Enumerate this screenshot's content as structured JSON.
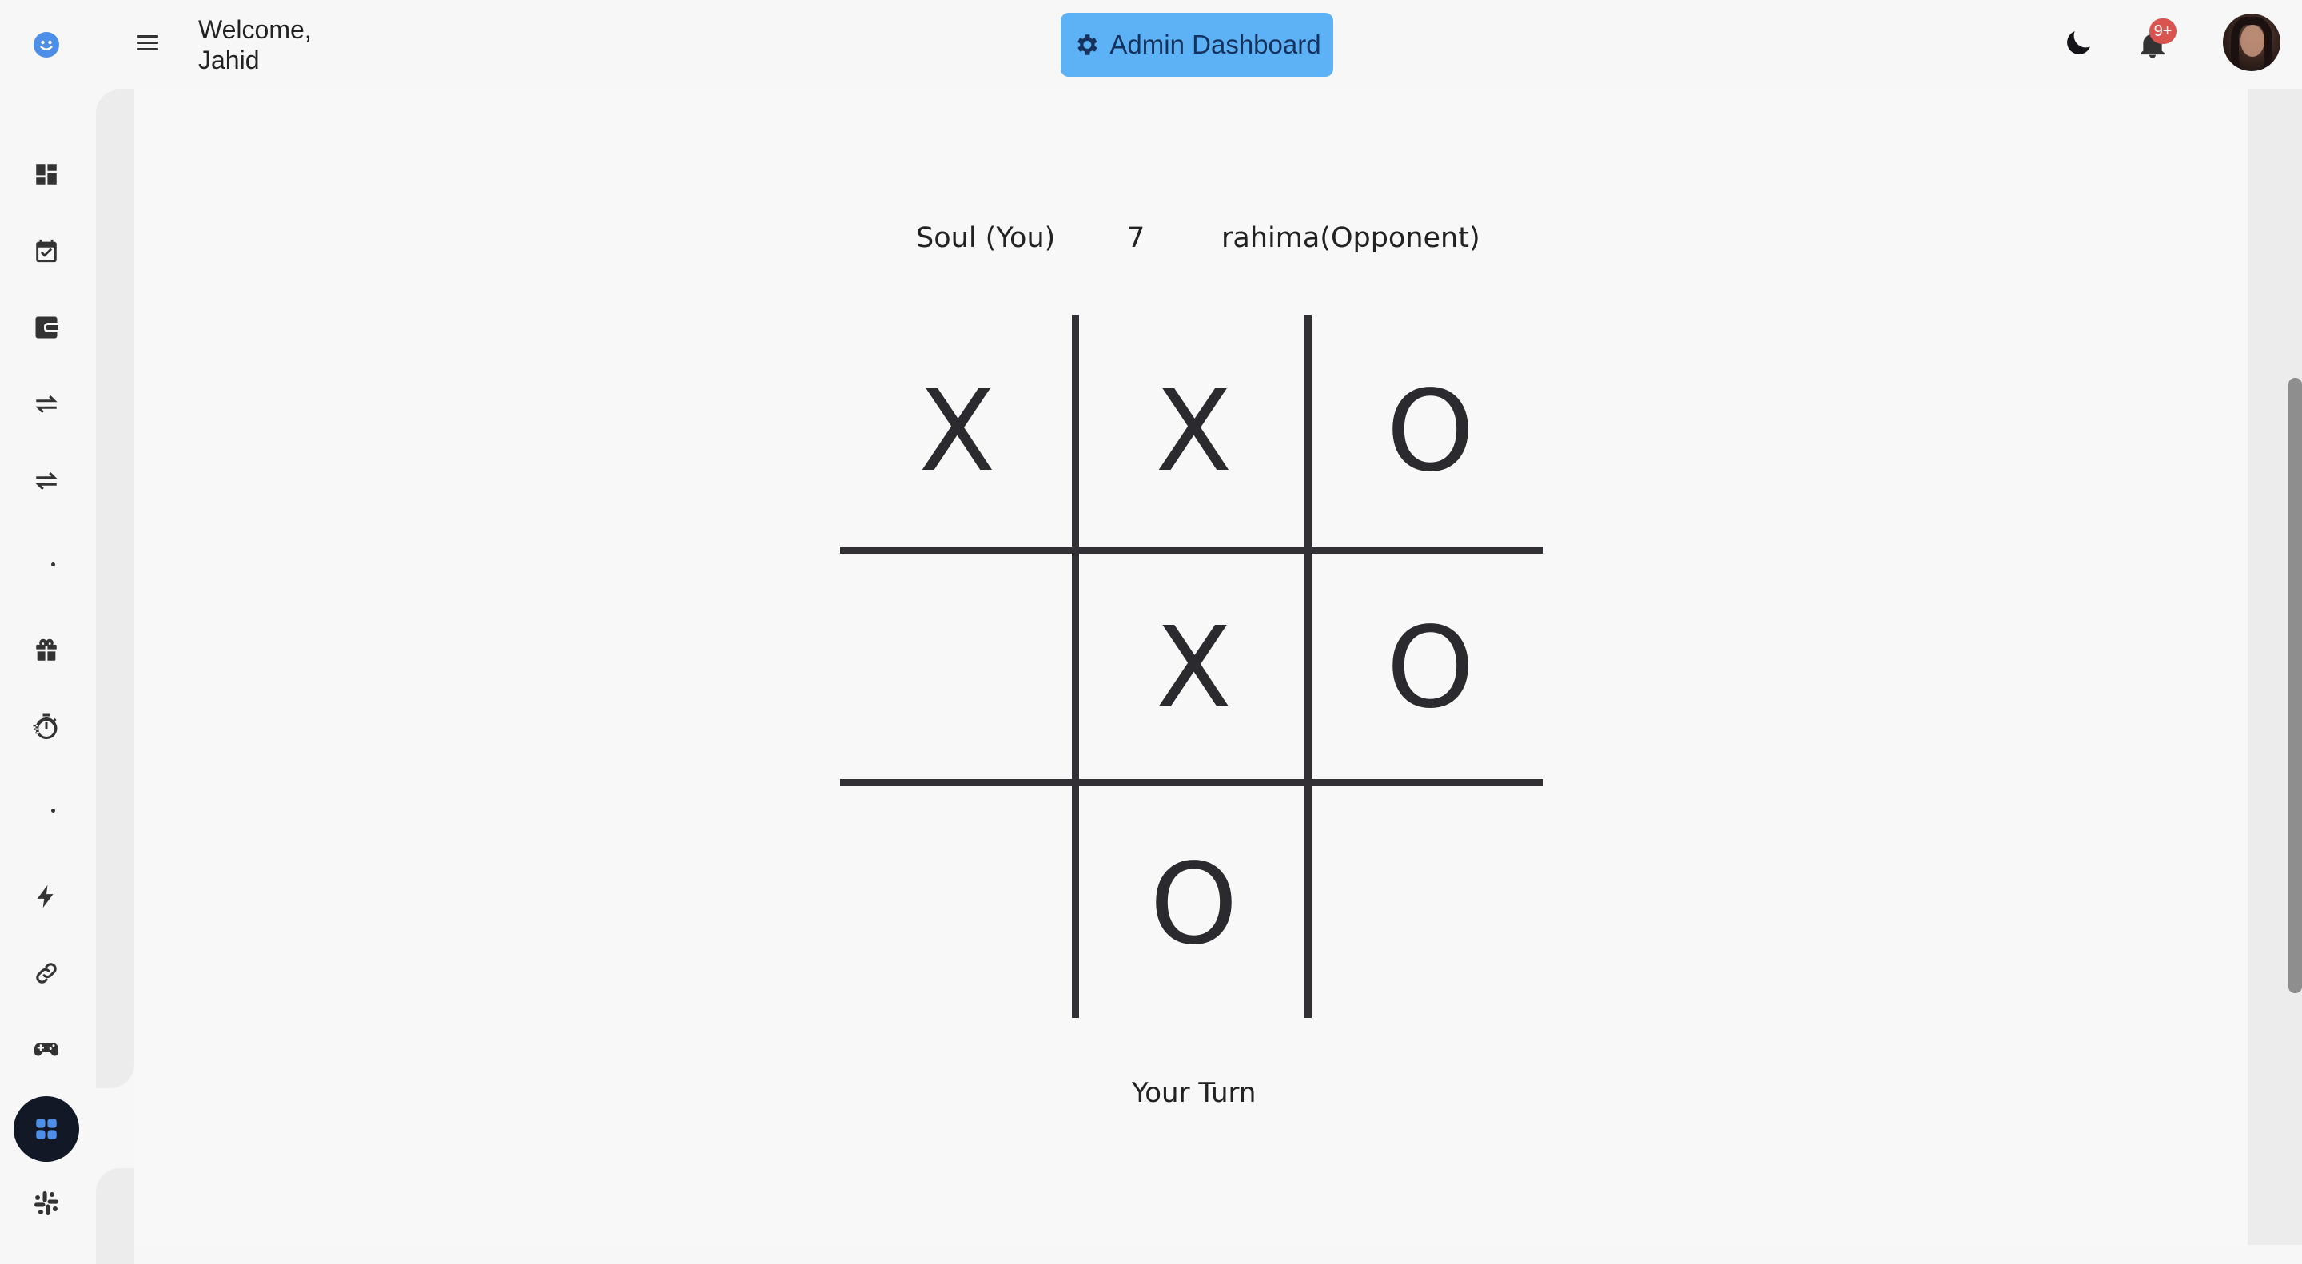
{
  "header": {
    "welcome_line1": "Welcome,",
    "welcome_line2": "Jahid",
    "admin_button": "Admin Dashboard",
    "notification_badge": "9+"
  },
  "sidebar": {
    "items": [
      {
        "icon": "dashboard-icon"
      },
      {
        "icon": "calendar-check-icon"
      },
      {
        "icon": "wallet-icon"
      },
      {
        "icon": "transfer-icon"
      },
      {
        "icon": "transfer-icon"
      },
      {
        "icon": "gift-icon"
      },
      {
        "icon": "stopwatch-icon"
      },
      {
        "icon": "bolt-icon"
      },
      {
        "icon": "link-icon"
      },
      {
        "icon": "gamepad-icon"
      },
      {
        "icon": "apps-icon",
        "active": true
      },
      {
        "icon": "slack-icon"
      }
    ]
  },
  "game": {
    "player_you": "Soul (You)",
    "score": "7",
    "player_opponent": "rahima(Opponent)",
    "board": [
      [
        "X",
        "X",
        "O"
      ],
      [
        "",
        "X",
        "O"
      ],
      [
        "",
        "O",
        ""
      ]
    ],
    "status": "Your Turn"
  },
  "colors": {
    "accent": "#5db2f5",
    "active_nav": "#121826",
    "badge": "#d9534f",
    "board_lines": "#333035"
  }
}
